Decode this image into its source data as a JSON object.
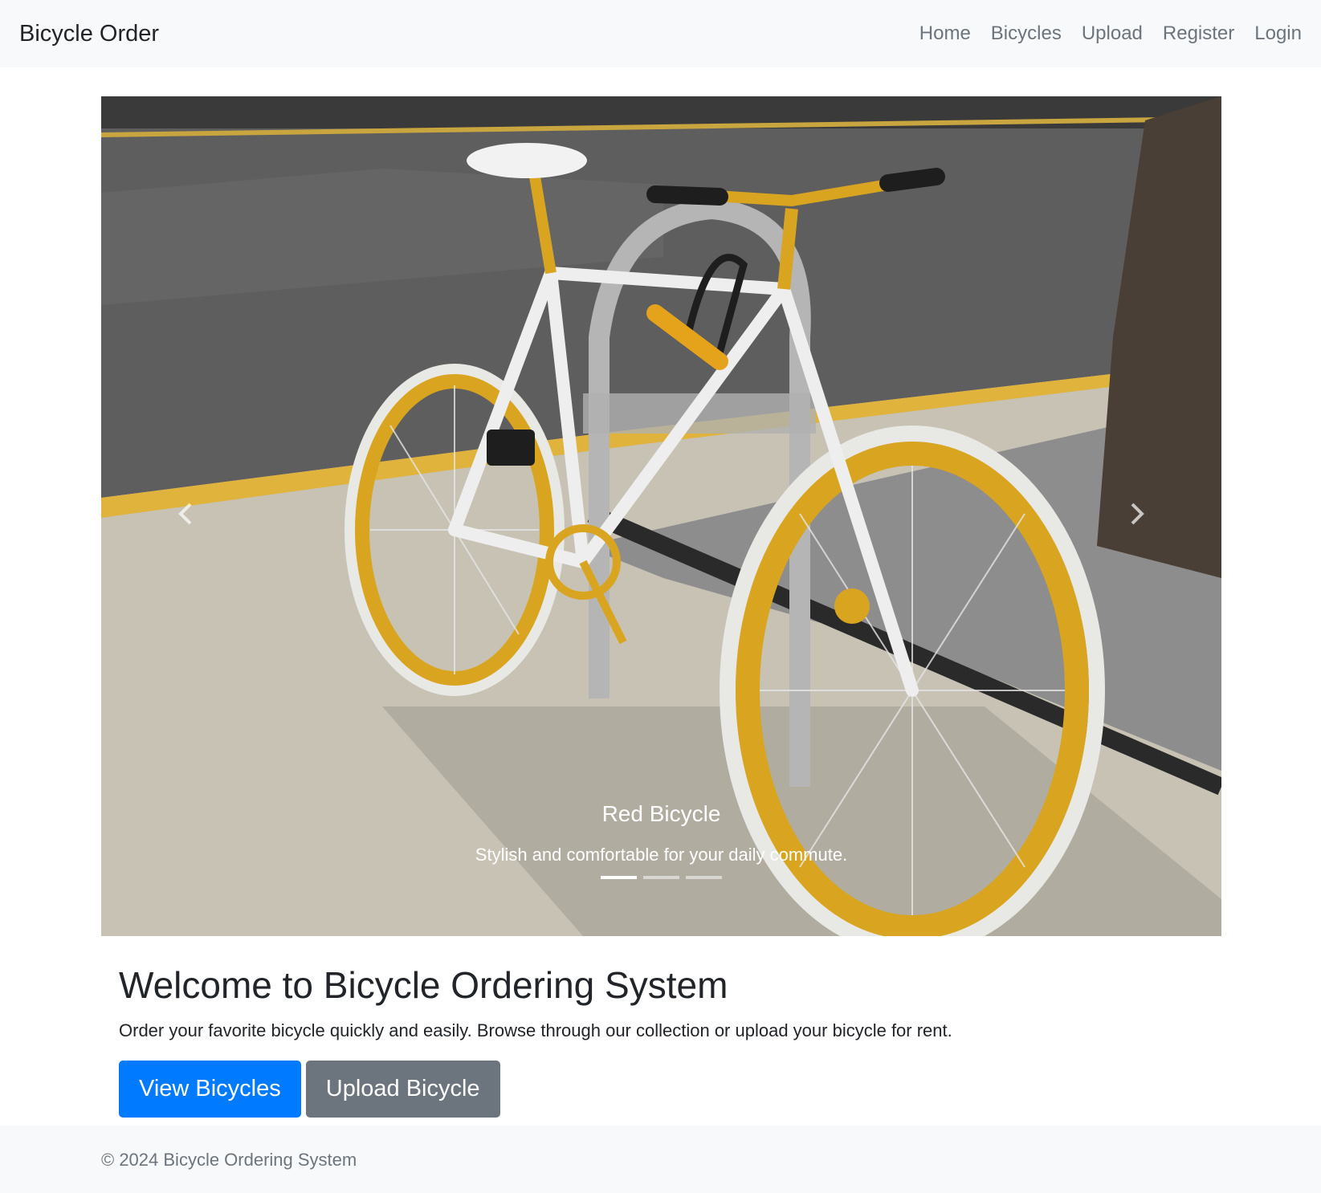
{
  "navbar": {
    "brand": "Bicycle Order",
    "links": [
      "Home",
      "Bicycles",
      "Upload",
      "Register",
      "Login"
    ]
  },
  "carousel": {
    "slide": {
      "title": "Red Bicycle",
      "text": "Stylish and comfortable for your daily commute."
    },
    "slide_count": 3,
    "active_index": 0
  },
  "intro": {
    "heading": "Welcome to Bicycle Ordering System",
    "lead": "Order your favorite bicycle quickly and easily. Browse through our collection or upload your bicycle for rent.",
    "primary_button": "View Bicycles",
    "secondary_button": "Upload Bicycle"
  },
  "footer": {
    "text": "© 2024 Bicycle Ordering System"
  },
  "colors": {
    "primary": "#007bff",
    "secondary": "#6c757d",
    "navbar_bg": "#f8f9fa",
    "rim_gold": "#d9a520"
  },
  "icons": {
    "prev": "chevron-left-icon",
    "next": "chevron-right-icon"
  }
}
